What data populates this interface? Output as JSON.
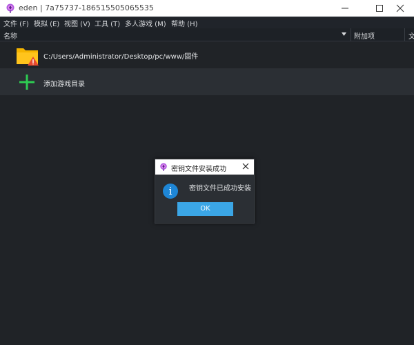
{
  "window": {
    "title": "eden | 7a75737-186515505065535"
  },
  "menu": {
    "file": "文件 (F)",
    "emulation": "模拟 (E)",
    "view": "视图 (V)",
    "tools": "工具 (T)",
    "multiplayer": "多人游戏 (M)",
    "help": "帮助 (H)"
  },
  "columns": {
    "name": "名称",
    "addons": "附加项",
    "filetype": "文"
  },
  "list": {
    "folder_path": "C:/Users/Administrator/Desktop/pc/www/固件",
    "add_dir_label": "添加游戏目录"
  },
  "dialog": {
    "title": "密钥文件安装成功",
    "message": "密钥文件已成功安装",
    "ok_label": "OK",
    "info_glyph": "i"
  },
  "colors": {
    "accent": "#3ba6e6",
    "background": "#202327",
    "folder": "#f5b400",
    "warning": "#e84a2f",
    "add_icon": "#2ecc52",
    "info": "#1e86d6"
  }
}
